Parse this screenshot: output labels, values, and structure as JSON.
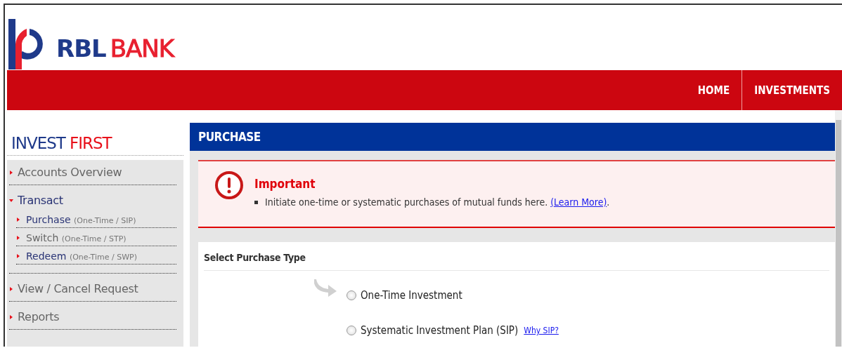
{
  "logo": {
    "first": "RBL",
    "second": "BANK"
  },
  "nav": [
    {
      "label": "HOME"
    },
    {
      "label": "INVESTMENTS"
    }
  ],
  "sidebar": {
    "title_first": "INVEST",
    "title_second": "FIRST",
    "items": [
      {
        "label": "Accounts Overview",
        "expanded": false,
        "highlighted": false
      },
      {
        "label": "Transact",
        "expanded": true,
        "highlighted": true,
        "children": [
          {
            "label": "Purchase",
            "note": "(One-Time / SIP)",
            "highlighted": true
          },
          {
            "label": "Switch",
            "note": "(One-Time / STP)",
            "highlighted": false
          },
          {
            "label": "Redeem",
            "note": "(One-Time / SWP)",
            "highlighted": true
          }
        ]
      },
      {
        "label": "View / Cancel Request",
        "expanded": false,
        "highlighted": false
      },
      {
        "label": "Reports",
        "expanded": false,
        "highlighted": false
      }
    ]
  },
  "main": {
    "title": "PURCHASE",
    "alert": {
      "title": "Important",
      "text": "Initiate one-time or systematic purchases of mutual funds here.",
      "link": "(Learn More)",
      "after": "."
    },
    "section": "Select Purchase Type",
    "options": [
      {
        "label": "One-Time Investment",
        "selected": false
      },
      {
        "label": "Systematic Investment Plan (SIP)",
        "selected": false,
        "link": "Why SIP?"
      }
    ]
  }
}
